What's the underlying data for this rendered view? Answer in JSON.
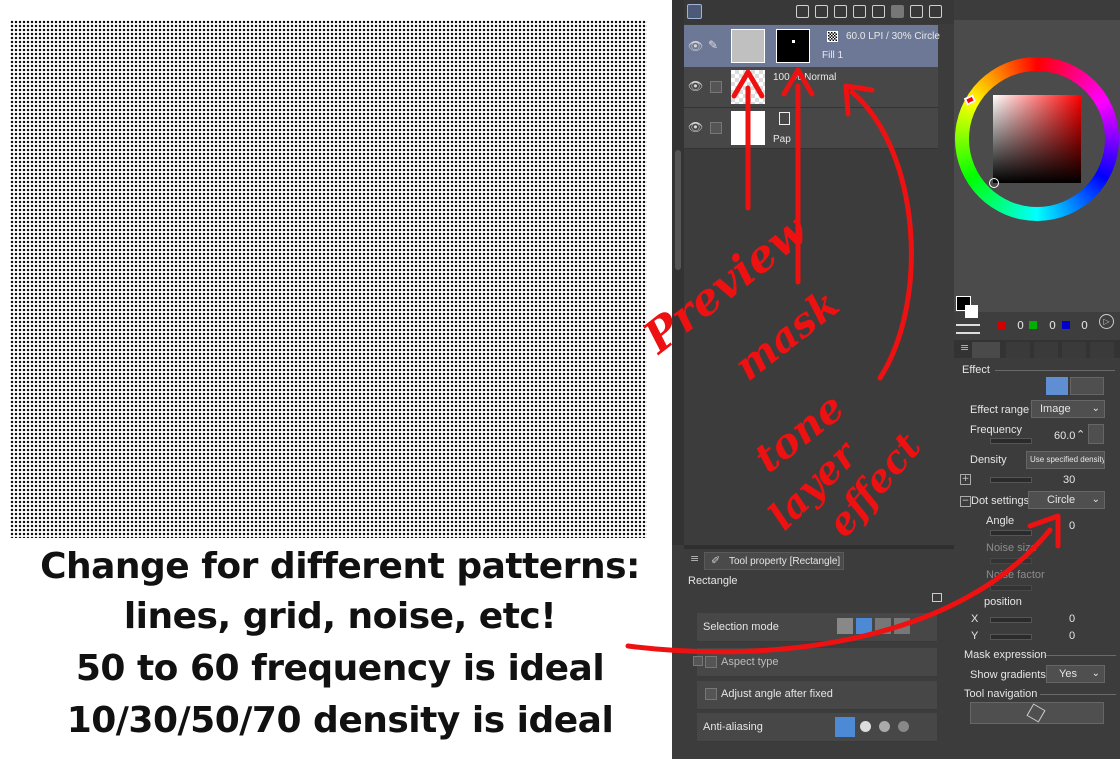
{
  "caption": {
    "line1": "Change for different patterns:",
    "line2": "lines, grid, noise, etc!",
    "line3": "50 to 60 frequency is ideal",
    "line4": "10/30/50/70 density is ideal"
  },
  "layers": [
    {
      "line1": "60.0 LPI / 30% Circle",
      "line2": "Fill 1"
    },
    {
      "line1": "100 % Normal",
      "line2": ""
    },
    {
      "line1": "",
      "line2": "Pap"
    }
  ],
  "annotations": {
    "preview": "Preview",
    "mask": "mask",
    "tone": "tone",
    "layer": "layer",
    "effect": "effect"
  },
  "tool_property": {
    "tab_label": "Tool property [Rectangle]",
    "tool_name": "Rectangle",
    "selection_mode": "Selection mode",
    "aspect_type": "Aspect type",
    "adjust_angle": "Adjust angle after fixed",
    "anti_aliasing": "Anti-aliasing"
  },
  "color": {
    "r": "0",
    "g": "0",
    "b": "0",
    "red": "#d40000",
    "green": "#00b000",
    "blue": "#0000cc"
  },
  "effect_panel": {
    "effect_header": "Effect",
    "effect_range_label": "Effect range",
    "effect_range_value": "Image",
    "frequency_label": "Frequency",
    "frequency_value": "60.0",
    "density_label": "Density",
    "density_mode": "Use specified density",
    "density_value": "30",
    "dot_settings_label": "Dot settings",
    "dot_settings_value": "Circle",
    "angle_label": "Angle",
    "angle_value": "0",
    "noise_size_label": "Noise size",
    "noise_factor_label": "Noise factor",
    "position_label": "position",
    "x_label": "X",
    "x_value": "0",
    "y_label": "Y",
    "y_value": "0",
    "mask_expression_header": "Mask expression",
    "show_gradients_label": "Show gradients",
    "show_gradients_value": "Yes",
    "tool_navigation_header": "Tool navigation"
  }
}
